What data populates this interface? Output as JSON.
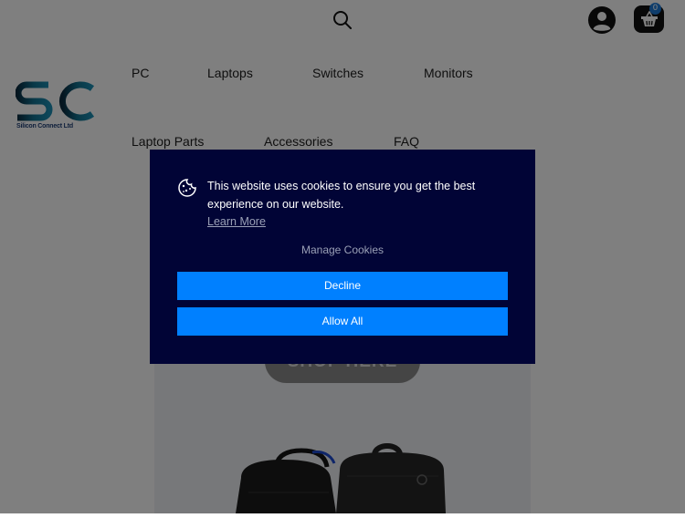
{
  "header": {
    "cart_count": "0",
    "logo_caption": "Silicon Connect Ltd"
  },
  "nav": {
    "items": [
      {
        "label": "PC"
      },
      {
        "label": "Laptops"
      },
      {
        "label": "Switches"
      },
      {
        "label": "Monitors"
      },
      {
        "label": "Laptop Parts"
      },
      {
        "label": "Accessories"
      },
      {
        "label": "FAQ"
      }
    ]
  },
  "hero": {
    "button_label": "SHOP HERE"
  },
  "cookie": {
    "message": "This website uses cookies to ensure you get the best experience on our website.",
    "learn_more": "Learn More",
    "manage": "Manage Cookies",
    "decline": "Decline",
    "allow": "Allow All"
  },
  "colors": {
    "dialog_background": "#010436",
    "button_blue": "#0080ff",
    "cart_badge": "#1d7bd8"
  },
  "icons": {
    "search": "search-icon",
    "account": "account-icon",
    "cart": "basket-icon",
    "cookie": "cookie-icon"
  }
}
